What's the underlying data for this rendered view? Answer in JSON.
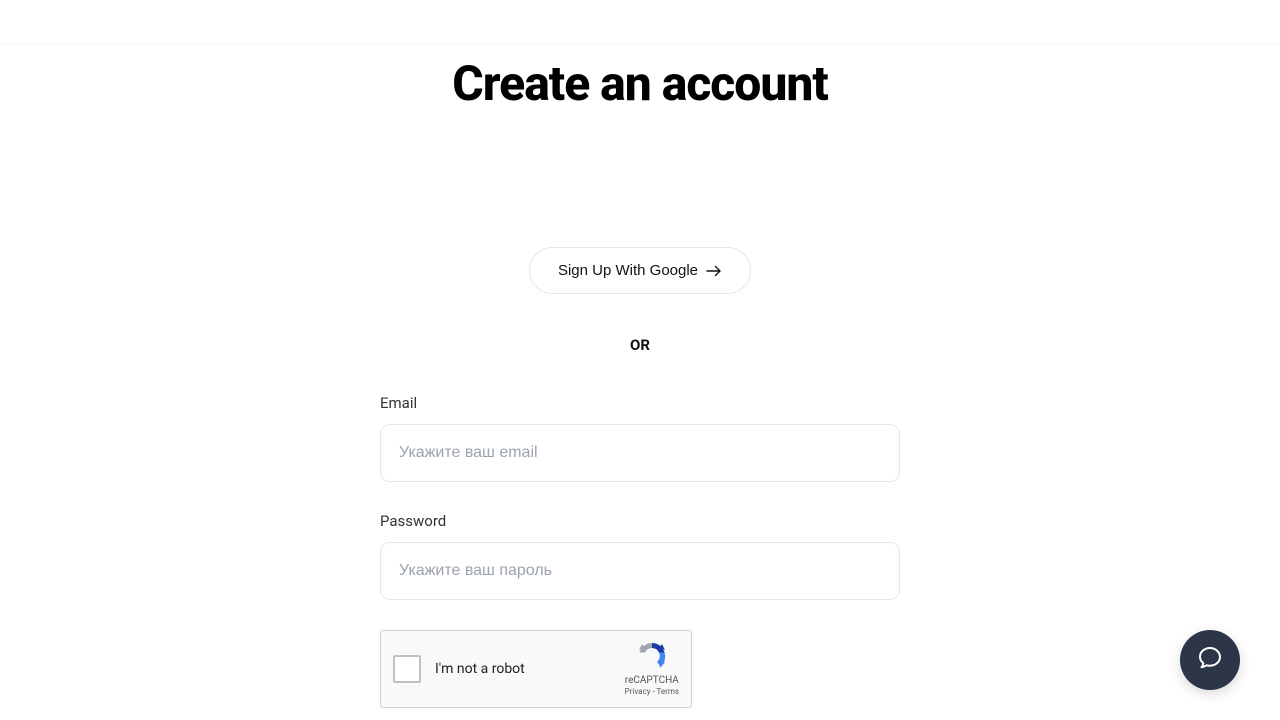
{
  "title": "Create an account",
  "google_button": {
    "label": "Sign Up With Google"
  },
  "divider": {
    "or_label": "OR"
  },
  "form": {
    "email": {
      "label": "Email",
      "placeholder": "Укажите ваш email",
      "value": ""
    },
    "password": {
      "label": "Password",
      "placeholder": "Укажите ваш пароль",
      "value": ""
    }
  },
  "recaptcha": {
    "label": "I'm not a robot",
    "brand": "reCAPTCHA",
    "privacy": "Privacy",
    "separator": " - ",
    "terms": "Terms"
  }
}
